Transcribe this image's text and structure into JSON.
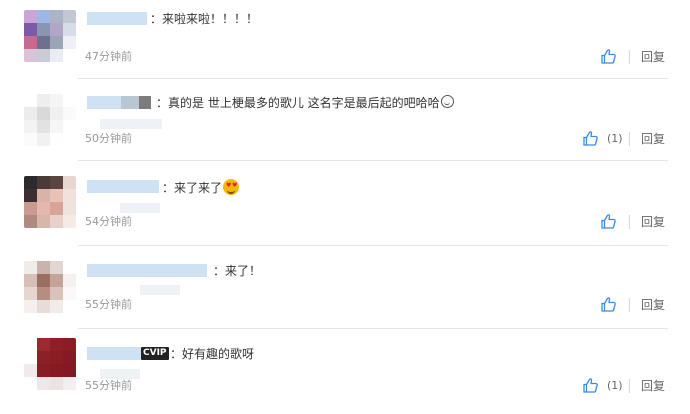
{
  "comments": [
    {
      "text": "：来啦来啦！！！！",
      "time": "47分钟前",
      "like_count": "",
      "reply": "回复",
      "avatar_colors": [
        "#c9a6d6",
        "#9db7e6",
        "#a9b4c4",
        "#c0c8d2",
        "#7b5aa8",
        "#8a96b0",
        "#b0a7c8",
        "#d7dde6",
        "#c46b8f",
        "#6f6f8f",
        "#9aa5b8",
        "#eef0f3",
        "#d8c4d9",
        "#c9ccd6",
        "#e9ecf0",
        "#ffffff"
      ]
    },
    {
      "text": "：真的是 世上梗最多的歌儿 这名字是最后起的吧哈哈",
      "time": "50分钟前",
      "like_count": "(1)",
      "reply": "回复",
      "avatar_colors": [
        "#ffffff",
        "#eeeeee",
        "#f5f5f5",
        "#ffffff",
        "#ececec",
        "#d9d9d9",
        "#f0f0f0",
        "#fafafa",
        "#f3f3f3",
        "#e2e2e2",
        "#f6f6f6",
        "#ffffff",
        "#fbfbfb",
        "#f1f1f1",
        "#fefefe",
        "#ffffff"
      ]
    },
    {
      "text": "：来了来了",
      "time": "54分钟前",
      "like_count": "",
      "reply": "回复",
      "avatar_colors": [
        "#2b2b2b",
        "#4a3a38",
        "#5a4540",
        "#e8d6d0",
        "#3b2f2f",
        "#d9b3a8",
        "#e7c2b5",
        "#f1e0db",
        "#c99b90",
        "#e4b9ad",
        "#d7a597",
        "#efe3df",
        "#b08a82",
        "#d8b6aa",
        "#e9d0c8",
        "#f4ebe8"
      ]
    },
    {
      "text": "：来了！",
      "time": "55分钟前",
      "like_count": "",
      "reply": "回复",
      "avatar_colors": [
        "#f0ece9",
        "#c9b3ab",
        "#e3d6d1",
        "#ffffff",
        "#d6bfb6",
        "#9a6f62",
        "#c4a49a",
        "#f6f0ee",
        "#e6d6cf",
        "#b78d80",
        "#d9c2ba",
        "#fbf8f7",
        "#f5efed",
        "#e7dcd8",
        "#f2ebe8",
        "#ffffff"
      ]
    },
    {
      "text": "：好有趣的歌呀",
      "time": "55分钟前",
      "like_count": "(1)",
      "reply": "回复",
      "avatar_colors": [
        "#ffffff",
        "#9a2a30",
        "#8e1f26",
        "#8a1c24",
        "#ffffff",
        "#8e1f26",
        "#8a1c24",
        "#861a22",
        "#f2e9ea",
        "#8a1c24",
        "#861a22",
        "#841a21",
        "#ffffff",
        "#f0e6e7",
        "#ece2e3",
        "#f5eeee"
      ]
    }
  ],
  "vip_badge": "CVIP",
  "colors": {
    "like_blue": "#3a8be0",
    "time_grey": "#999999",
    "username_blur": "#bcd7f0"
  }
}
